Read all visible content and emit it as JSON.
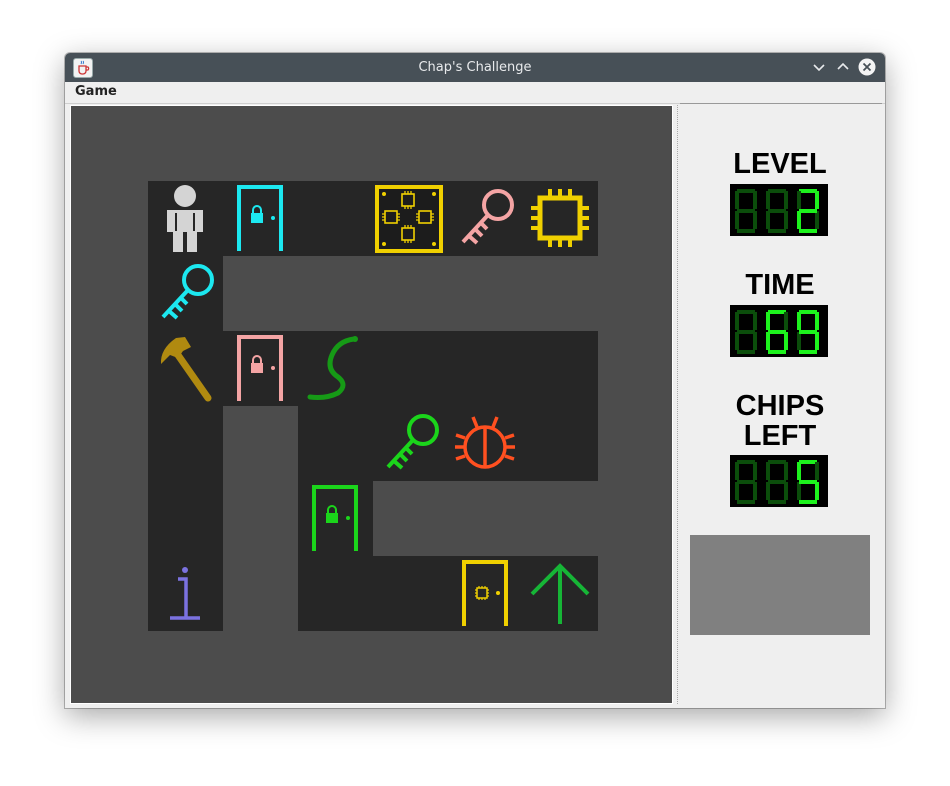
{
  "window": {
    "title": "Chap's Challenge",
    "app_icon": "java-cup-icon",
    "controls": [
      "minimize-icon",
      "maximize-icon",
      "close-icon"
    ]
  },
  "menu": {
    "game_label": "Game"
  },
  "board": {
    "tiles": [
      {
        "row": 0,
        "col": 0,
        "kind": "chap-player"
      },
      {
        "row": 0,
        "col": 1,
        "kind": "cyan-locked-door"
      },
      {
        "row": 0,
        "col": 2,
        "kind": "floor"
      },
      {
        "row": 0,
        "col": 3,
        "kind": "chip-socket"
      },
      {
        "row": 0,
        "col": 4,
        "kind": "pink-key"
      },
      {
        "row": 0,
        "col": 5,
        "kind": "treasure-chip"
      },
      {
        "row": 1,
        "col": 0,
        "kind": "cyan-key"
      },
      {
        "row": 2,
        "col": 0,
        "kind": "hammer"
      },
      {
        "row": 2,
        "col": 1,
        "kind": "pink-locked-door"
      },
      {
        "row": 2,
        "col": 2,
        "kind": "green-snake"
      },
      {
        "row": 2,
        "col": 3,
        "kind": "floor"
      },
      {
        "row": 2,
        "col": 4,
        "kind": "floor"
      },
      {
        "row": 2,
        "col": 5,
        "kind": "floor"
      },
      {
        "row": 3,
        "col": 0,
        "kind": "floor"
      },
      {
        "row": 3,
        "col": 2,
        "kind": "floor"
      },
      {
        "row": 3,
        "col": 3,
        "kind": "green-key"
      },
      {
        "row": 3,
        "col": 4,
        "kind": "red-bug"
      },
      {
        "row": 3,
        "col": 5,
        "kind": "floor"
      },
      {
        "row": 4,
        "col": 0,
        "kind": "floor"
      },
      {
        "row": 4,
        "col": 2,
        "kind": "green-locked-door"
      },
      {
        "row": 5,
        "col": 0,
        "kind": "info"
      },
      {
        "row": 5,
        "col": 2,
        "kind": "floor"
      },
      {
        "row": 5,
        "col": 3,
        "kind": "floor"
      },
      {
        "row": 5,
        "col": 4,
        "kind": "yellow-exit-door"
      },
      {
        "row": 5,
        "col": 5,
        "kind": "green-up-arrow"
      }
    ]
  },
  "sidebar": {
    "level_label": "LEVEL",
    "time_label": "TIME",
    "chips_label_line1": "CHIPS",
    "chips_label_line2": "LEFT",
    "level_value": 2,
    "time_value": 69,
    "chips_left_value": 5,
    "lcd_on_color": "#1df21d",
    "lcd_off_color": "#0b4d0b"
  },
  "colors": {
    "cyan": "#1ce8f0",
    "pink": "#f4a4a4",
    "green": "#1bd51b",
    "yellow": "#f0d000",
    "bug_red": "#ff5020",
    "info_blue": "#7b72e0"
  }
}
